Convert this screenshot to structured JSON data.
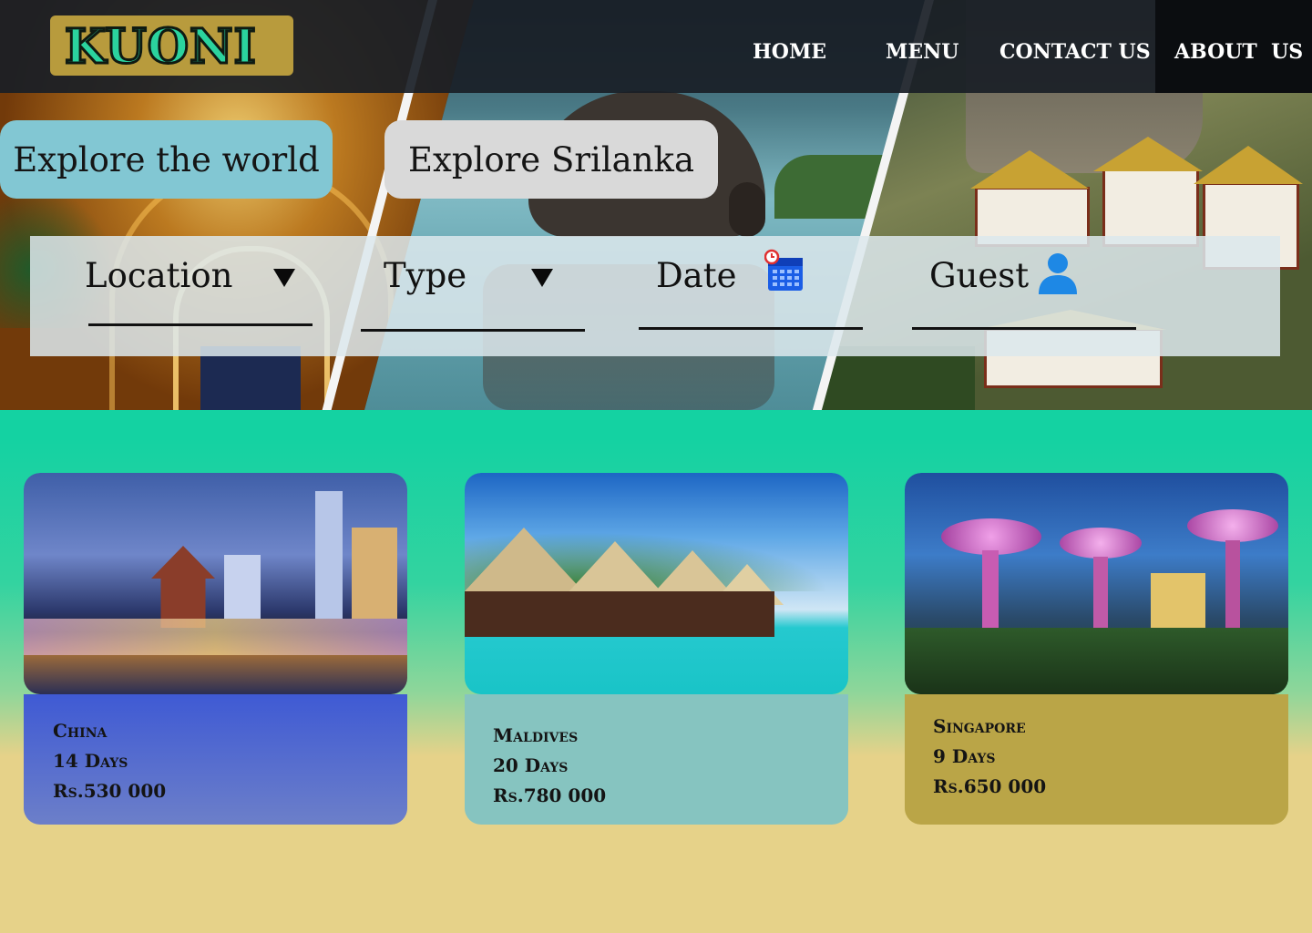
{
  "brand": {
    "logo_text": "KUONI"
  },
  "nav": {
    "links": [
      "HOME",
      "MENU",
      "CONTACT US",
      "ABOUT  US"
    ]
  },
  "tabs": [
    {
      "label": "Explore the world"
    },
    {
      "label": "Explore Srilanka"
    }
  ],
  "search": {
    "fields": [
      {
        "label": "Location",
        "icon": "dropdown-arrow-icon"
      },
      {
        "label": "Type",
        "icon": "dropdown-arrow-icon"
      },
      {
        "label": "Date",
        "icon": "calendar-icon"
      },
      {
        "label": "Guest",
        "icon": "user-icon"
      }
    ]
  },
  "packages": [
    {
      "destination": "China",
      "duration": "14 Days",
      "price": "Rs.530 000",
      "color": "#4a66d6"
    },
    {
      "destination": "Maldives",
      "duration": "20 Days",
      "price": "Rs.780 000",
      "color": "#86c4c0"
    },
    {
      "destination": "Singapore",
      "duration": "9 Days",
      "price": "Rs.650 000",
      "color": "#baa547"
    }
  ],
  "colors": {
    "accent_teal": "#14d2a2",
    "sand": "#e6d289",
    "logo_bg": "#b89b3d",
    "nav_bg": "#191e26"
  }
}
